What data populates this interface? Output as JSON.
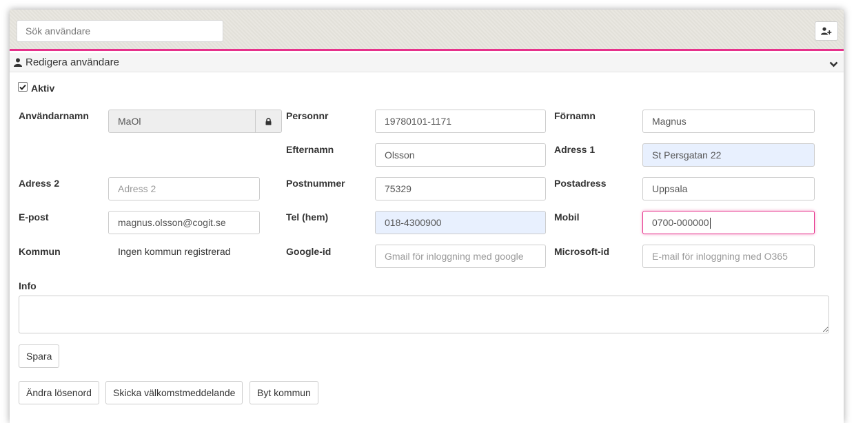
{
  "search": {
    "placeholder": "Sök användare"
  },
  "toolbar": {
    "add_user_icon": "user-plus-icon"
  },
  "panel": {
    "title": "Redigera användare",
    "user_icon": "user-icon",
    "collapse_icon": "chevron-down-icon"
  },
  "form": {
    "active_label": "Aktiv",
    "active_checked": true,
    "username_label": "Användarnamn",
    "username_value": "MaOl",
    "personnr_label": "Personnr",
    "personnr_value": "19780101-1171",
    "firstname_label": "Förnamn",
    "firstname_value": "Magnus",
    "lastname_label": "Efternamn",
    "lastname_value": "Olsson",
    "address1_label": "Adress 1",
    "address1_value": "St Persgatan 22",
    "address2_label": "Adress 2",
    "address2_placeholder": "Adress 2",
    "postnr_label": "Postnummer",
    "postnr_value": "75329",
    "city_label": "Postadress",
    "city_value": "Uppsala",
    "email_label": "E-post",
    "email_value": "magnus.olsson@cogit.se",
    "phone_label": "Tel (hem)",
    "phone_value": "018-4300900",
    "mobile_label": "Mobil",
    "mobile_value": "0700-000000",
    "municipality_label": "Kommun",
    "municipality_value": "Ingen kommun registrerad",
    "google_label": "Google-id",
    "google_placeholder": "Gmail för inloggning med google",
    "microsoft_label": "Microsoft-id",
    "microsoft_placeholder": "E-mail för inloggning med O365",
    "info_label": "Info"
  },
  "buttons": {
    "save": "Spara",
    "change_password": "Ändra lösenord",
    "send_welcome": "Skicka välkomstmeddelande",
    "change_municipality": "Byt kommun"
  },
  "colors": {
    "accent": "#e6318b",
    "autofill": "#e8f0fe"
  }
}
